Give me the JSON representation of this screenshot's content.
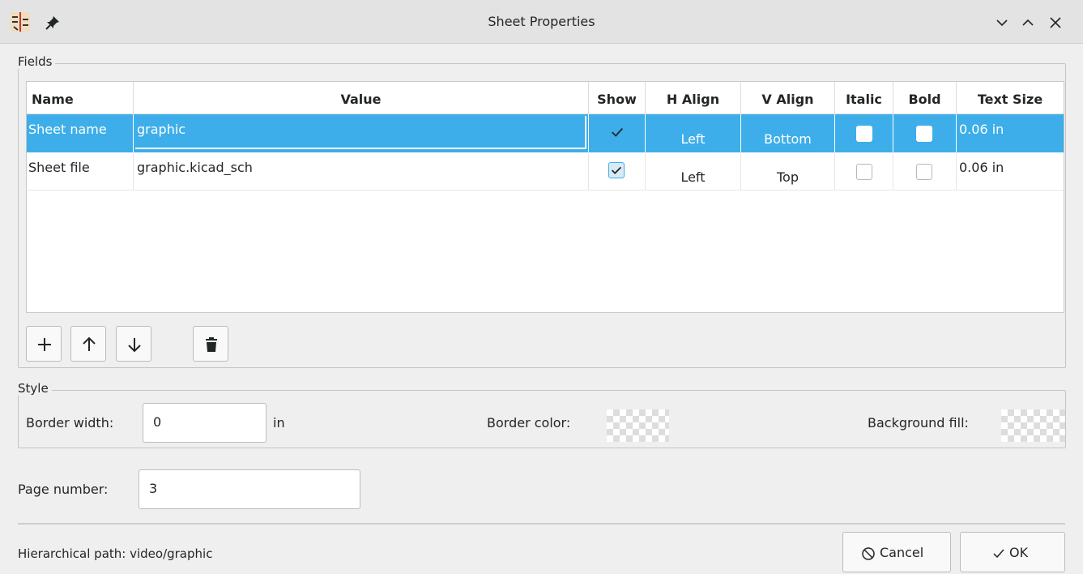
{
  "window": {
    "title": "Sheet Properties",
    "icons": [
      "kicad-schematic-app-icon",
      "pin-icon",
      "minimize-icon",
      "maximize-icon",
      "close-icon"
    ]
  },
  "fields_group": {
    "label": "Fields",
    "columns": [
      "Name",
      "Value",
      "Show",
      "H Align",
      "V Align",
      "Italic",
      "Bold",
      "Text Size"
    ],
    "rows": [
      {
        "name": "Sheet name",
        "value": "graphic",
        "show": true,
        "h_align": "Left",
        "v_align": "Bottom",
        "italic": false,
        "bold": false,
        "text_size": "0.06 in",
        "selected": true
      },
      {
        "name": "Sheet file",
        "value": "graphic.kicad_sch",
        "show": true,
        "h_align": "Left",
        "v_align": "Top",
        "italic": false,
        "bold": false,
        "text_size": "0.06 in",
        "selected": false
      }
    ],
    "tool_buttons": [
      "add-field-icon",
      "move-up-icon",
      "move-down-icon",
      "delete-icon"
    ]
  },
  "style_group": {
    "label": "Style",
    "border_width_label": "Border width:",
    "border_width_value": "0",
    "border_width_unit": "in",
    "border_color_label": "Border color:",
    "background_fill_label": "Background fill:"
  },
  "page_number": {
    "label": "Page number:",
    "value": "3"
  },
  "footer": {
    "hierarchical_path": "Hierarchical path: video/graphic",
    "cancel_label": "Cancel",
    "ok_label": "OK"
  },
  "colors": {
    "selection": "#3daee9",
    "window_bg": "#efefef",
    "titlebar_bg": "#e3e3e3"
  }
}
